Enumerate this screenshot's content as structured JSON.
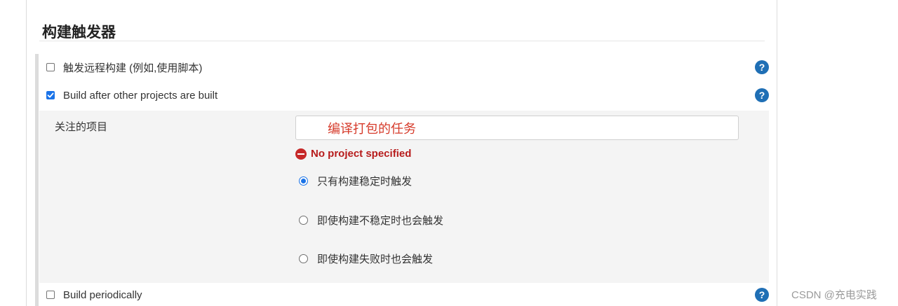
{
  "section": {
    "title": "构建触发器"
  },
  "triggers": {
    "remote": {
      "label": "触发远程构建 (例如,使用脚本)",
      "checked": false
    },
    "after_other": {
      "label": "Build after other projects are built",
      "checked": true
    },
    "periodic": {
      "label": "Build periodically",
      "checked": false
    }
  },
  "help_icon": {
    "glyph": "?",
    "icon": "help-icon",
    "color": "#1f6fb5"
  },
  "watched_projects": {
    "label": "关注的项目",
    "value": "编译打包的任务",
    "error": "No project specified"
  },
  "trigger_conditions": [
    {
      "label": "只有构建稳定时触发",
      "selected": true
    },
    {
      "label": "即使构建不稳定时也会触发",
      "selected": false
    },
    {
      "label": "即使构建失败时也会触发",
      "selected": false
    }
  ],
  "watermark": "CSDN @充电实践"
}
